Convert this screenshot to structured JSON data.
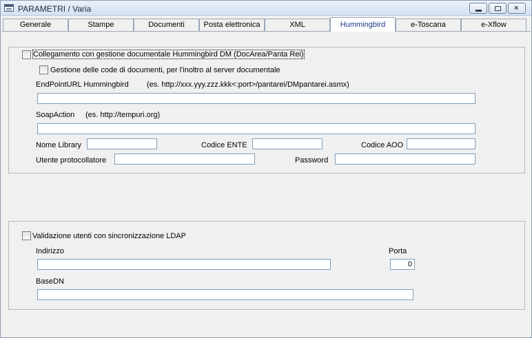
{
  "window": {
    "title": "PARAMETRI / Varia"
  },
  "tabs": [
    {
      "label": "Generale"
    },
    {
      "label": "Stampe"
    },
    {
      "label": "Documenti"
    },
    {
      "label": "Posta elettronica"
    },
    {
      "label": "XML"
    },
    {
      "label": "Hummingbird"
    },
    {
      "label": "e-Toscana"
    },
    {
      "label": "e-Xflow"
    }
  ],
  "active_tab": "Hummingbird",
  "hummingbird": {
    "enable_label": "Collegamento con gestione documentale Hummingbird DM (DocArea/Panta Rei)",
    "queue_label": "Gestione delle code di documenti, per l'inoltro al server documentale",
    "endpoint_label": "EndPointURL Hummingbird",
    "endpoint_hint": "(es. http://xxx.yyy.zzz.kkk<:port>/pantarei/DMpantarei.asmx)",
    "endpoint_value": "",
    "soap_label": "SoapAction",
    "soap_hint": "(es. http://tempuri.org)",
    "soap_value": "",
    "library_label": "Nome Library",
    "library_value": "",
    "ente_label": "Codice ENTE",
    "ente_value": "",
    "aoo_label": "Codice AOO",
    "aoo_value": "",
    "user_label": "Utente protocollatore",
    "user_value": "",
    "password_label": "Password",
    "password_value": ""
  },
  "ldap": {
    "enable_label": "Validazione utenti con sincronizzazione LDAP",
    "address_label": "Indirizzo",
    "address_value": "",
    "port_label": "Porta",
    "port_value": "0",
    "basedn_label": "BaseDN",
    "basedn_value": ""
  }
}
